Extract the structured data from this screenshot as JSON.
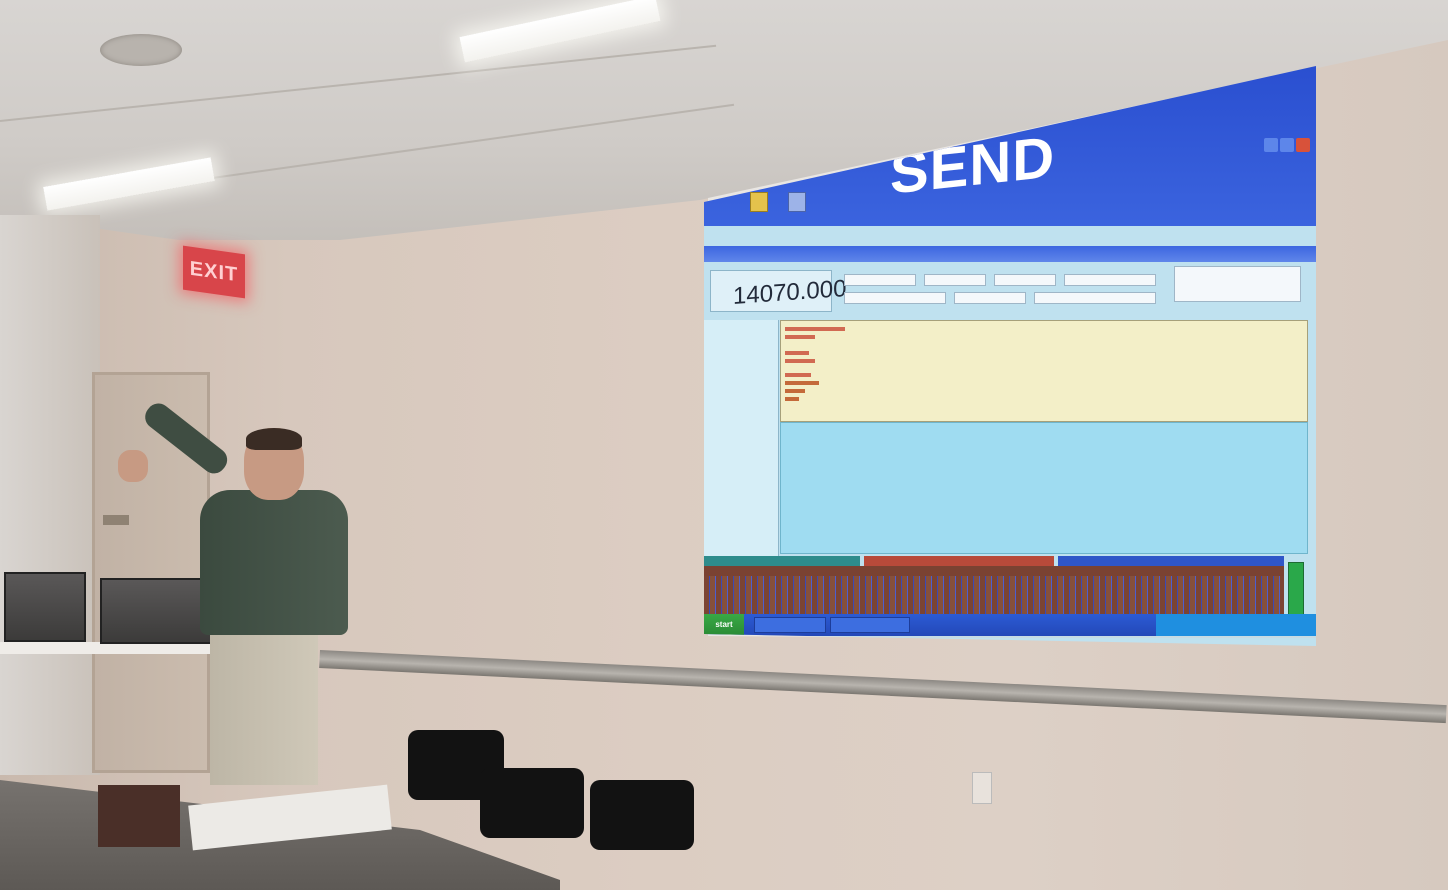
{
  "scene": {
    "exit_sign": "EXIT",
    "projector_screen": {
      "window_title": "SEND",
      "frequency": "14070.000",
      "toolbar_buttons": [
        {
          "icon": "folder-icon"
        },
        {
          "icon": "save-icon"
        }
      ],
      "taskbar": {
        "start_label": "start"
      }
    }
  },
  "colors": {
    "window_title_bar": "#2f58d6",
    "receive_pane": "#f3efc8",
    "transmit_pane": "#9fdcf1",
    "waterfall_base": "#7b4433",
    "waterfall_signal": "#3a49b6",
    "exit_sign": "#d8454a",
    "shirt": "#3f4d42"
  }
}
